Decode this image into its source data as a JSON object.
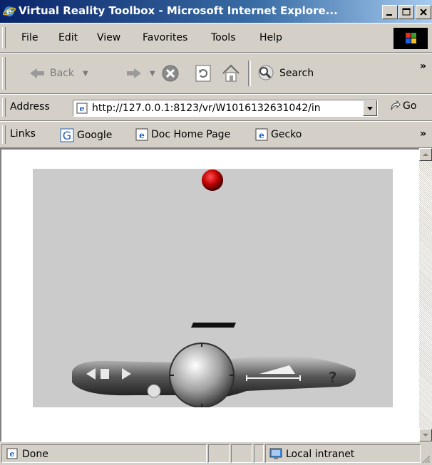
{
  "window": {
    "title": "Virtual Reality Toolbox - Microsoft Internet Explore..."
  },
  "menu": {
    "items": [
      "File",
      "Edit",
      "View",
      "Favorites",
      "Tools",
      "Help"
    ]
  },
  "toolbar": {
    "back_label": "Back",
    "search_label": "Search"
  },
  "address": {
    "label": "Address",
    "url": "http://127.0.0.1:8123/vr/W1016132631042/in",
    "go_label": "Go"
  },
  "links": {
    "label": "Links",
    "items": [
      "Google",
      "Doc Home Page",
      "Gecko"
    ]
  },
  "status": {
    "text": "Done",
    "zone": "Local intranet"
  },
  "colors": {
    "title_start": "#0a246a",
    "title_end": "#a6caf0",
    "chrome": "#d4d0c8",
    "scene_bg": "#cbcbcb",
    "ball": "#cc0000"
  }
}
